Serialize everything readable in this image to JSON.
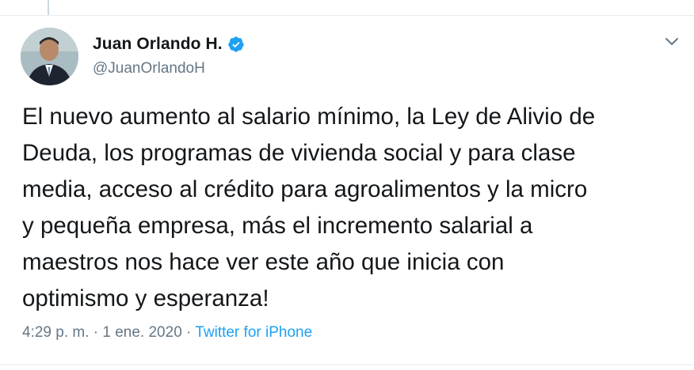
{
  "tweet": {
    "display_name": "Juan Orlando H.",
    "handle": "@JuanOrlandoH",
    "text": "El nuevo aumento al salario mínimo, la Ley de Alivio de\nDeuda, los programas de vivienda social y para clase\nmedia, acceso al crédito para agroalimentos y la micro\ny pequeña empresa, más el incremento salarial a\nmaestros nos hace ver este año que inicia con\noptimismo y esperanza!",
    "time": "4:29 p. m.",
    "separator": " · ",
    "date": "1 ene. 2020",
    "source": "Twitter for iPhone"
  },
  "icons": {
    "verified": "verified-badge-icon",
    "caret": "chevron-down-icon"
  },
  "colors": {
    "accent": "#1da1f2",
    "text_primary": "#14171a",
    "text_secondary": "#657786",
    "border": "#e6ecf0"
  }
}
